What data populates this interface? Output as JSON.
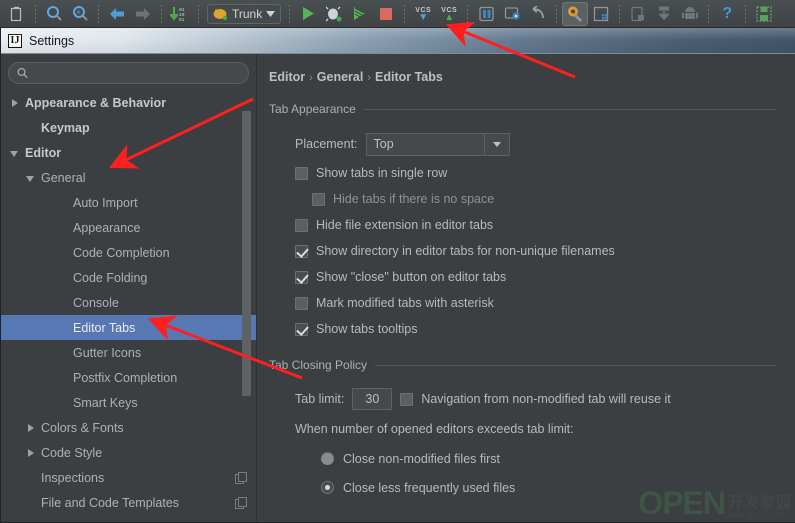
{
  "toolbar": {
    "items": [
      {
        "name": "open-file-icon",
        "glyph": "❐",
        "type": "icon"
      },
      {
        "name": "search-icon",
        "glyph": "⌕",
        "type": "icon"
      },
      {
        "name": "search-structurally-icon",
        "glyph": "⌕",
        "type": "icon"
      },
      {
        "name": "back-icon",
        "glyph": "←",
        "type": "icon"
      },
      {
        "name": "forward-icon",
        "glyph": "→",
        "type": "icon"
      },
      {
        "name": "sync-icon",
        "glyph": "↓",
        "type": "icon"
      },
      {
        "name": "run-icon",
        "glyph": "▶",
        "type": "icon"
      },
      {
        "name": "debug-icon",
        "glyph": "🐞",
        "type": "icon"
      },
      {
        "name": "run-coverage-icon",
        "glyph": "▶",
        "type": "icon"
      },
      {
        "name": "stop-icon",
        "glyph": "■",
        "type": "icon"
      },
      {
        "name": "update-project-icon",
        "glyph": "VCS",
        "type": "icon"
      },
      {
        "name": "commit-changes-icon",
        "glyph": "VCS",
        "type": "icon"
      },
      {
        "name": "sdk-manager-icon",
        "glyph": "▤",
        "type": "icon"
      },
      {
        "name": "avd-manager-icon",
        "glyph": "◱",
        "type": "icon"
      },
      {
        "name": "undo-icon",
        "glyph": "↶",
        "type": "icon"
      },
      {
        "name": "settings-gear-icon",
        "glyph": "⚙",
        "type": "icon"
      },
      {
        "name": "project-structure-icon",
        "glyph": "▦",
        "type": "icon"
      },
      {
        "name": "device-monitor-icon",
        "glyph": "▭",
        "type": "icon"
      },
      {
        "name": "sync-gradle-icon",
        "glyph": "⤓",
        "type": "icon"
      },
      {
        "name": "android-icon",
        "glyph": "☢",
        "type": "icon"
      },
      {
        "name": "help-icon",
        "glyph": "?",
        "type": "icon"
      },
      {
        "name": "save-all-icon",
        "glyph": "💾",
        "type": "icon"
      }
    ],
    "run_config": {
      "label": "Trunk",
      "icon": "android-app-icon"
    },
    "vcs_update_label": "VCS",
    "vcs_commit_label": "VCS",
    "help_label": "?"
  },
  "window": {
    "title": "Settings",
    "icon_text": "IJ"
  },
  "search": {
    "value": "",
    "placeholder": "",
    "icon": "search-icon"
  },
  "sidebar": {
    "items": [
      {
        "label": "Appearance & Behavior",
        "indent": 0,
        "arrow": "right",
        "bold": true,
        "selected": false,
        "copy": false
      },
      {
        "label": "Keymap",
        "indent": 1,
        "arrow": "none",
        "bold": true,
        "selected": false,
        "copy": false
      },
      {
        "label": "Editor",
        "indent": 0,
        "arrow": "down",
        "bold": true,
        "selected": false,
        "copy": false
      },
      {
        "label": "General",
        "indent": 1,
        "arrow": "down",
        "bold": false,
        "selected": false,
        "copy": false
      },
      {
        "label": "Auto Import",
        "indent": 3,
        "arrow": "none",
        "bold": false,
        "selected": false,
        "copy": false
      },
      {
        "label": "Appearance",
        "indent": 3,
        "arrow": "none",
        "bold": false,
        "selected": false,
        "copy": false
      },
      {
        "label": "Code Completion",
        "indent": 3,
        "arrow": "none",
        "bold": false,
        "selected": false,
        "copy": false
      },
      {
        "label": "Code Folding",
        "indent": 3,
        "arrow": "none",
        "bold": false,
        "selected": false,
        "copy": false
      },
      {
        "label": "Console",
        "indent": 3,
        "arrow": "none",
        "bold": false,
        "selected": false,
        "copy": false
      },
      {
        "label": "Editor Tabs",
        "indent": 3,
        "arrow": "none",
        "bold": false,
        "selected": true,
        "copy": false
      },
      {
        "label": "Gutter Icons",
        "indent": 3,
        "arrow": "none",
        "bold": false,
        "selected": false,
        "copy": false
      },
      {
        "label": "Postfix Completion",
        "indent": 3,
        "arrow": "none",
        "bold": false,
        "selected": false,
        "copy": false
      },
      {
        "label": "Smart Keys",
        "indent": 3,
        "arrow": "none",
        "bold": false,
        "selected": false,
        "copy": false
      },
      {
        "label": "Colors & Fonts",
        "indent": 1,
        "arrow": "right",
        "bold": false,
        "selected": false,
        "copy": false
      },
      {
        "label": "Code Style",
        "indent": 1,
        "arrow": "right",
        "bold": false,
        "selected": false,
        "copy": false
      },
      {
        "label": "Inspections",
        "indent": 1,
        "arrow": "none",
        "bold": false,
        "selected": false,
        "copy": true
      },
      {
        "label": "File and Code Templates",
        "indent": 1,
        "arrow": "none",
        "bold": false,
        "selected": false,
        "copy": true
      }
    ]
  },
  "breadcrumb": {
    "parts": [
      "Editor",
      "General",
      "Editor Tabs"
    ],
    "separator": "›"
  },
  "tab_appearance": {
    "group_title": "Tab Appearance",
    "placement_label": "Placement:",
    "placement_value": "Top",
    "checkboxes": [
      {
        "label": "Show tabs in single row",
        "checked": false,
        "dim": false,
        "indent": 0
      },
      {
        "label": "Hide tabs if there is no space",
        "checked": false,
        "dim": true,
        "indent": 1
      },
      {
        "label": "Hide file extension in editor tabs",
        "checked": false,
        "dim": false,
        "indent": 0
      },
      {
        "label": "Show directory in editor tabs for non-unique filenames",
        "checked": true,
        "dim": false,
        "indent": 0
      },
      {
        "label": "Show \"close\" button on editor tabs",
        "checked": true,
        "dim": false,
        "indent": 0
      },
      {
        "label": "Mark modified tabs with asterisk",
        "checked": false,
        "dim": false,
        "indent": 0
      },
      {
        "label": "Show tabs tooltips",
        "checked": true,
        "dim": false,
        "indent": 0
      }
    ]
  },
  "tab_closing": {
    "group_title": "Tab Closing Policy",
    "tab_limit_label": "Tab limit:",
    "tab_limit_value": "30",
    "navigation_label": "Navigation from non-modified tab will reuse it",
    "navigation_checked": false,
    "exceeds_label": "When number of opened editors exceeds tab limit:",
    "radios": [
      {
        "label": "Close non-modified files first",
        "selected": false
      },
      {
        "label": "Close less frequently used files",
        "selected": true
      }
    ]
  },
  "watermark": {
    "open": "OPEN",
    "cn": "开发家园",
    "url": "www.openjq.com"
  },
  "colors": {
    "accent_selection": "#5878b4",
    "panel_bg": "#3c3f41",
    "annotation_arrow": "#ff1f1f",
    "run_green": "#45b045"
  }
}
